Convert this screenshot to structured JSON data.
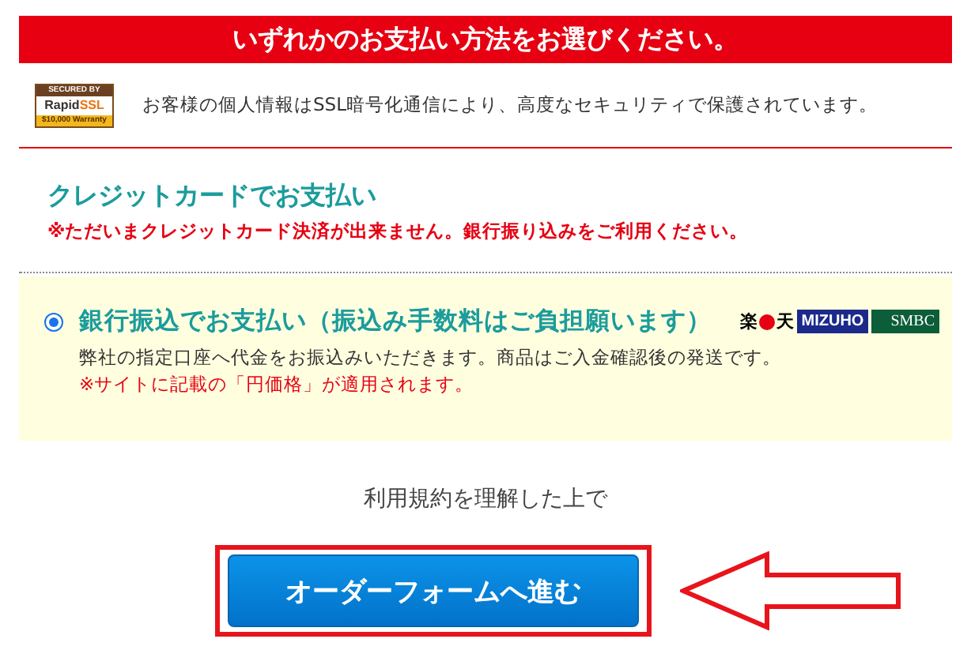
{
  "header": {
    "title": "いずれかのお支払い方法をお選びください。"
  },
  "security": {
    "seal": {
      "caption": "SECURED BY",
      "brand": "Rapid",
      "brand_accent": "SSL",
      "warranty": "$10,000 Warranty"
    },
    "text": "お客様の個人情報はSSL暗号化通信により、高度なセキュリティで保護されています。"
  },
  "credit_card": {
    "title": "クレジットカードでお支払い",
    "notice": "※ただいまクレジットカード決済が出来ません。銀行振り込みをご利用ください。"
  },
  "bank_transfer": {
    "selected": true,
    "title": "銀行振込でお支払い（振込み手数料はご負担願います）",
    "description": "弊社の指定口座へ代金をお振込みいただきます。商品はご入金確認後の発送です。",
    "notice": "※サイトに記載の「円価格」が適用されます。",
    "bank_logos": [
      {
        "kind": "rakuten",
        "text": "楽天"
      },
      {
        "kind": "mizuho",
        "text": "MIZUHO"
      },
      {
        "kind": "smbc",
        "text": "SMBC"
      }
    ]
  },
  "agreement": "利用規約を理解した上で",
  "submit_button": "オーダーフォームへ進む"
}
